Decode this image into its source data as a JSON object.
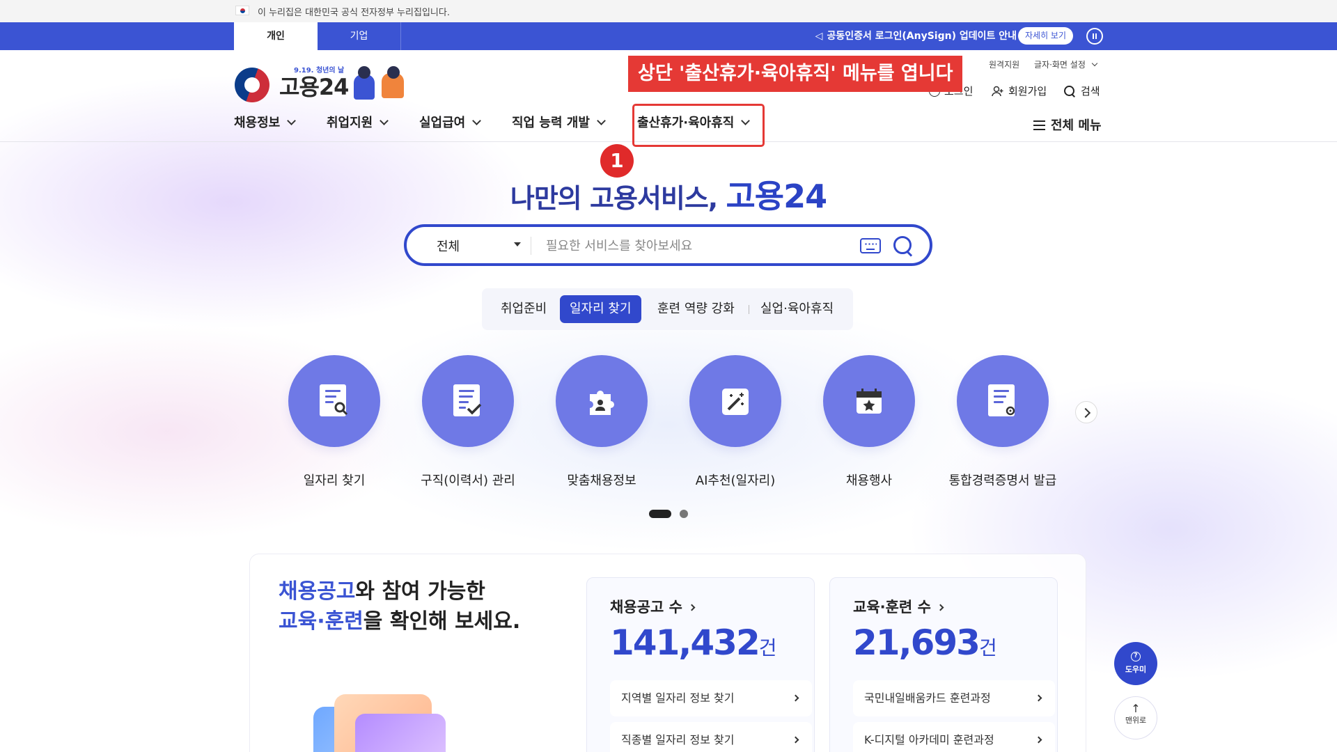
{
  "gov_banner": {
    "text": "이 누리집은 대한민국 공식 전자정부 누리집입니다."
  },
  "top_tabs": {
    "personal": "개인",
    "company": "기업"
  },
  "notice": {
    "icon": "megaphone-icon",
    "text": "공동인증서 로그인(AnySign) 업데이트 안내",
    "detail_button": "자세히 보기"
  },
  "logo": {
    "name": "고용24",
    "sub": "9.19. 청년의 날"
  },
  "utility": {
    "top_partial": "원격지원",
    "text_settings": "글자·화면 설정",
    "login": "로그인",
    "signup": "회원가입",
    "search": "검색"
  },
  "nav": {
    "items": [
      "채용정보",
      "취업지원",
      "실업급여",
      "직업 능력 개발",
      "출산휴가·육아휴직"
    ],
    "all_menu": "전체 메뉴"
  },
  "annotation": {
    "text": "상단 '출산휴가·육아휴직' 메뉴를 엽니다",
    "step": "1",
    "color": "#e53935"
  },
  "hero": {
    "title_prefix": "나만의 고용서비스,",
    "title_brand": "고용24"
  },
  "search": {
    "select_value": "전체",
    "placeholder": "필요한 서비스를 찾아보세요",
    "value": ""
  },
  "category_tabs": {
    "items": [
      "취업준비",
      "일자리 찾기",
      "훈련 역량 강화",
      "실업·육아휴직"
    ],
    "active": "일자리 찾기"
  },
  "services": [
    {
      "label": "일자리 찾기",
      "icon": "job-search-icon"
    },
    {
      "label": "구직(이력서) 관리",
      "icon": "resume-check-icon"
    },
    {
      "label": "맞춤채용정보",
      "icon": "puzzle-person-icon"
    },
    {
      "label": "AI추천(일자리)",
      "icon": "magic-wand-icon"
    },
    {
      "label": "채용행사",
      "icon": "calendar-star-icon"
    },
    {
      "label": "통합경력증명서 발급",
      "icon": "certificate-icon"
    }
  ],
  "carousel": {
    "page": 1,
    "total": 2
  },
  "panel": {
    "headline_line1_accent": "채용공고",
    "headline_line1_rest": "와 참여 가능한",
    "headline_line2_accent": "교육·훈련",
    "headline_line2_rest": "을 확인해 보세요."
  },
  "stats": [
    {
      "title": "채용공고 수",
      "number": "141,432",
      "unit": "건",
      "links": [
        "지역별 일자리 정보 찾기",
        "직종별 일자리 정보 찾기"
      ]
    },
    {
      "title": "교육·훈련 수",
      "number": "21,693",
      "unit": "건",
      "links": [
        "국민내일배움카드 훈련과정",
        "K-디지털 아카데미 훈련과정"
      ]
    }
  ],
  "floating": {
    "help": "도우미",
    "top": "맨위로"
  },
  "colors": {
    "primary": "#3148cc",
    "strip": "#3b54d3",
    "circle": "#6f79e6",
    "annotation": "#e53935"
  }
}
